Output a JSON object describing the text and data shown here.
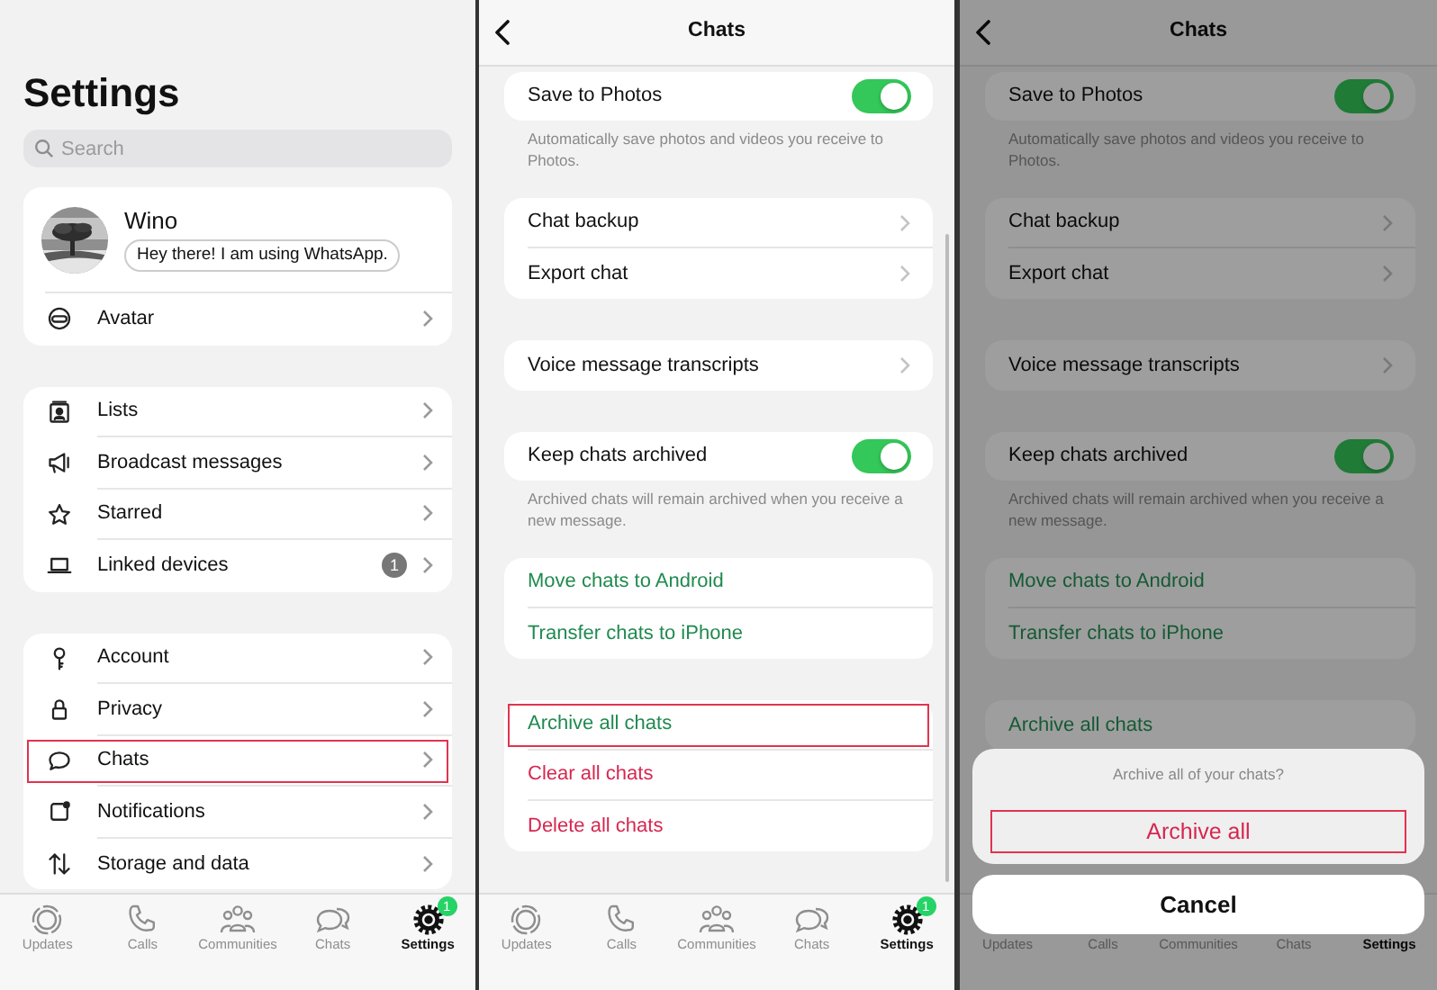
{
  "settings_screen": {
    "title": "Settings",
    "search": {
      "placeholder": "Search"
    },
    "profile": {
      "name": "Wino",
      "status": "Hey there! I am using WhatsApp."
    },
    "profile_items": [
      {
        "label": "Avatar",
        "highlighted": false
      }
    ],
    "groups": [
      {
        "items": [
          {
            "label": "Lists",
            "highlighted": false
          },
          {
            "label": "Broadcast messages",
            "highlighted": false
          },
          {
            "label": "Starred",
            "highlighted": false
          },
          {
            "label": "Linked devices",
            "badge": "1",
            "highlighted": false
          }
        ]
      },
      {
        "items": [
          {
            "label": "Account",
            "highlighted": false
          },
          {
            "label": "Privacy",
            "highlighted": false
          },
          {
            "label": "Chats",
            "highlighted": true
          },
          {
            "label": "Notifications",
            "highlighted": false
          },
          {
            "label": "Storage and data",
            "highlighted": false
          }
        ]
      }
    ],
    "tab_bar": [
      {
        "label": "Updates",
        "selected": false
      },
      {
        "label": "Calls",
        "selected": false
      },
      {
        "label": "Communities",
        "selected": false
      },
      {
        "label": "Chats",
        "selected": false
      },
      {
        "label": "Settings",
        "selected": true,
        "badge": "1"
      }
    ]
  },
  "chats_screen": {
    "title": "Chats",
    "groups": [
      {
        "items": [
          {
            "kind": "toggle",
            "label": "Save to Photos",
            "on": true,
            "highlighted": false
          }
        ],
        "note": "Automatically save photos and videos you receive to Photos."
      },
      {
        "items": [
          {
            "kind": "link",
            "label": "Chat backup",
            "highlighted": false
          },
          {
            "kind": "link",
            "label": "Export chat",
            "highlighted": false
          }
        ]
      },
      {
        "items": [
          {
            "kind": "link",
            "label": "Voice message transcripts",
            "highlighted": false
          }
        ]
      },
      {
        "items": [
          {
            "kind": "toggle",
            "label": "Keep chats archived",
            "on": true,
            "highlighted": false
          }
        ],
        "note": "Archived chats will remain archived when you receive a new message."
      },
      {
        "items": [
          {
            "kind": "action",
            "label": "Move chats to Android",
            "color": "#1f8a4f",
            "highlighted": false
          },
          {
            "kind": "action",
            "label": "Transfer chats to iPhone",
            "color": "#1f8a4f",
            "highlighted": false
          }
        ]
      },
      {
        "items": [
          {
            "kind": "action",
            "label": "Archive all chats",
            "color": "#1f8a4f",
            "highlighted": true
          },
          {
            "kind": "action",
            "label": "Clear all chats",
            "color": "#d6264f",
            "highlighted": false
          },
          {
            "kind": "action",
            "label": "Delete all chats",
            "color": "#d6264f",
            "highlighted": false
          }
        ]
      }
    ],
    "tab_bar": [
      {
        "label": "Updates",
        "selected": false
      },
      {
        "label": "Calls",
        "selected": false
      },
      {
        "label": "Communities",
        "selected": false
      },
      {
        "label": "Chats",
        "selected": false
      },
      {
        "label": "Settings",
        "selected": true,
        "badge": "1"
      }
    ]
  },
  "archive_prompt_screen": {
    "title": "Chats",
    "groups": [
      {
        "items": [
          {
            "kind": "toggle",
            "label": "Save to Photos",
            "on": true,
            "highlighted": false
          }
        ],
        "note": "Automatically save photos and videos you receive to Photos."
      },
      {
        "items": [
          {
            "kind": "link",
            "label": "Chat backup",
            "highlighted": false
          },
          {
            "kind": "link",
            "label": "Export chat",
            "highlighted": false
          }
        ]
      },
      {
        "items": [
          {
            "kind": "link",
            "label": "Voice message transcripts",
            "highlighted": false
          }
        ]
      },
      {
        "items": [
          {
            "kind": "toggle",
            "label": "Keep chats archived",
            "on": true,
            "highlighted": false
          }
        ],
        "note": "Archived chats will remain archived when you receive a new message."
      },
      {
        "items": [
          {
            "kind": "action",
            "label": "Move chats to Android",
            "color": "#155a34",
            "highlighted": false
          },
          {
            "kind": "action",
            "label": "Transfer chats to iPhone",
            "color": "#155a34",
            "highlighted": false
          }
        ]
      },
      {
        "items": [
          {
            "kind": "action",
            "label": "Archive all chats",
            "color": "#155a34",
            "highlighted": false
          }
        ]
      }
    ],
    "action_sheet": {
      "message": "Archive all of your chats?",
      "actions": [
        {
          "label": "Archive all",
          "highlighted": true
        }
      ],
      "cancel": "Cancel"
    },
    "tab_bar": [
      {
        "label": "Updates",
        "selected": false
      },
      {
        "label": "Calls",
        "selected": false
      },
      {
        "label": "Communities",
        "selected": false
      },
      {
        "label": "Chats",
        "selected": false
      },
      {
        "label": "Settings",
        "selected": true
      }
    ]
  }
}
